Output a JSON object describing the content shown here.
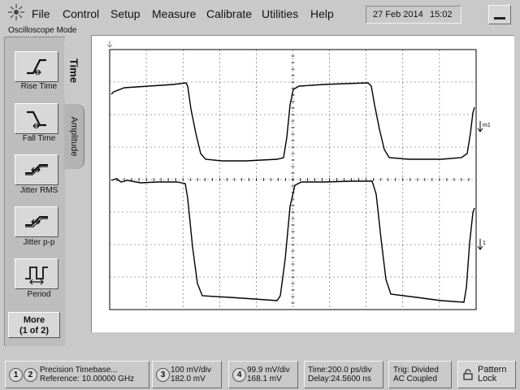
{
  "menubar": {
    "items": [
      "File",
      "Control",
      "Setup",
      "Measure",
      "Calibrate",
      "Utilities",
      "Help"
    ],
    "date": "27 Feb 2014",
    "time": "15:02"
  },
  "mode_label": "Oscilloscope Mode",
  "tabs": {
    "time": "Time",
    "amplitude": "Amplitude"
  },
  "measurements": [
    {
      "label": "Rise Time",
      "icon": "rise-time-icon"
    },
    {
      "label": "Fall Time",
      "icon": "fall-time-icon"
    },
    {
      "label": "Jitter RMS",
      "icon": "jitter-rms-icon"
    },
    {
      "label": "Jitter p-p",
      "icon": "jitter-pp-icon"
    },
    {
      "label": "Period",
      "icon": "period-icon"
    }
  ],
  "more_button": {
    "line1": "More",
    "line2": "(1 of 2)"
  },
  "waveform": {
    "markers": [
      "m1",
      "1"
    ],
    "trace_color": "#000000",
    "grid_color": "#555555"
  },
  "status": {
    "ch1": "1",
    "ch2": "2",
    "timebase_line1": "Precision Timebase...",
    "timebase_line2": "Reference: 10.00000 GHz",
    "ch3": "3",
    "ch3_line1": "100 mV/div",
    "ch3_line2": "182.0 mV",
    "ch4": "4",
    "ch4_line1": "99.9 mV/div",
    "ch4_line2": "168.1 mV",
    "time_line1": "Time:200.0 ps/div",
    "time_line2": "Delay:24.5600 ns",
    "trig_line1": "Trig: Divided",
    "trig_line2": "AC Coupled",
    "pattern_line1": "Pattern",
    "pattern_line2": "Lock"
  }
}
